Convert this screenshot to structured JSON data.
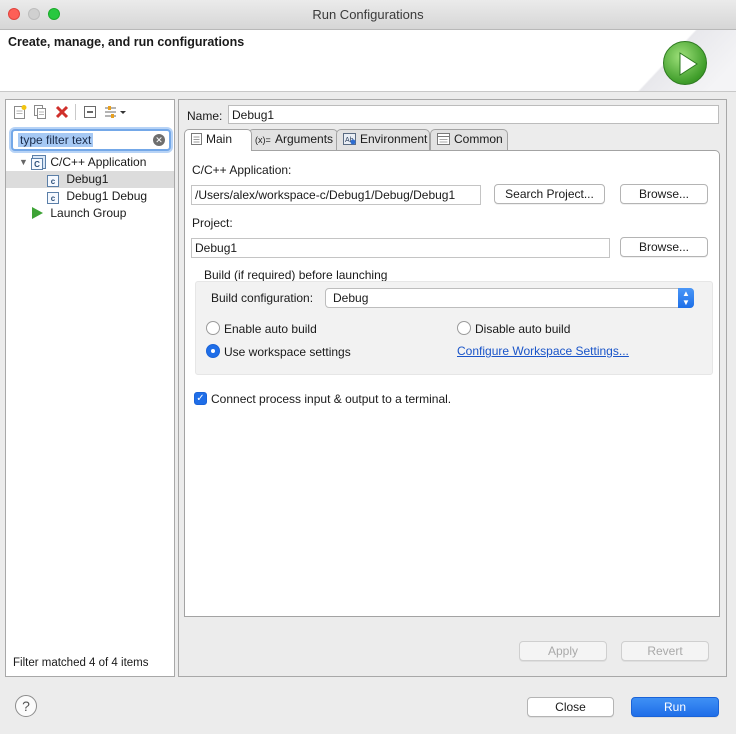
{
  "window": {
    "title": "Run Configurations"
  },
  "banner": {
    "heading": "Create, manage, and run configurations",
    "icon": "run-play-icon"
  },
  "left_toolbar": {
    "icons": [
      "new-configuration-icon",
      "duplicate-icon",
      "delete-icon",
      "collapse-all-icon",
      "filter-icon"
    ]
  },
  "filter": {
    "value": "type filter text"
  },
  "tree": {
    "category": "C/C++ Application",
    "items": [
      {
        "label": "Debug1"
      },
      {
        "label": "Debug1 Debug"
      }
    ],
    "launch_group": "Launch Group"
  },
  "left_status": "Filter matched 4 of 4 items",
  "config": {
    "name_label": "Name:",
    "name_value": "Debug1"
  },
  "tabs": [
    {
      "label": "Main",
      "icon": "main-tab-icon"
    },
    {
      "label": "Arguments",
      "icon": "arguments-tab-icon"
    },
    {
      "label": "Environment",
      "icon": "environment-tab-icon"
    },
    {
      "label": "Common",
      "icon": "common-tab-icon"
    }
  ],
  "main": {
    "app_label": "C/C++ Application:",
    "app_path": "/Users/alex/workspace-c/Debug1/Debug/Debug1",
    "search_project_label": "Search Project...",
    "browse_label": "Browse...",
    "project_label": "Project:",
    "project_value": "Debug1",
    "build_group_label": "Build (if required) before launching",
    "build_config_label": "Build configuration:",
    "build_config_value": "Debug",
    "enable_auto_build": "Enable auto build",
    "disable_auto_build": "Disable auto build",
    "use_workspace_settings": "Use workspace settings",
    "configure_workspace_link": "Configure Workspace Settings...",
    "terminal_checkbox_label": "Connect process input & output to a terminal.",
    "terminal_checked": true,
    "selected_build_option": "Use workspace settings"
  },
  "actions": {
    "apply": "Apply",
    "revert": "Revert",
    "close": "Close",
    "run": "Run",
    "help": "?"
  },
  "colors": {
    "accent": "#1f6ee8",
    "link": "#1a55c9",
    "run_icon": "#3f9d2a"
  }
}
